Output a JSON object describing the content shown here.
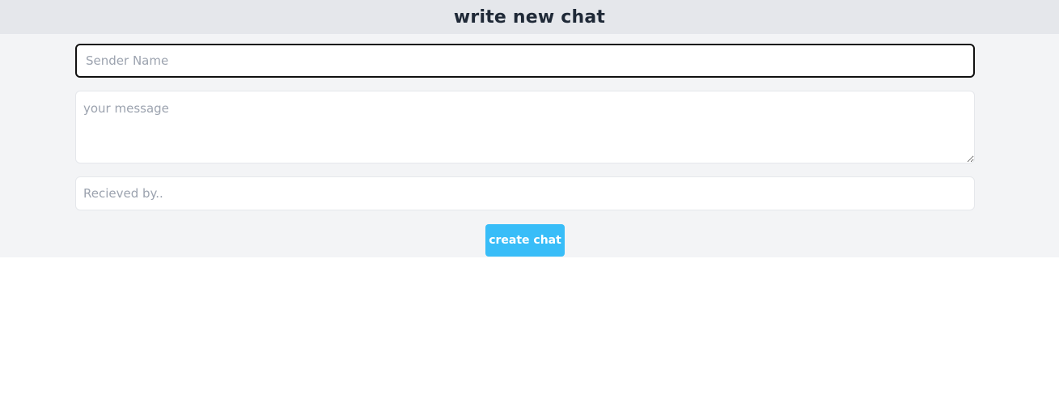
{
  "header": {
    "title": "write new chat"
  },
  "form": {
    "sender_placeholder": "Sender Name",
    "sender_value": "",
    "message_placeholder": "your message",
    "message_value": "",
    "receiver_placeholder": "Recieved by..",
    "receiver_value": "",
    "submit_label": "create chat"
  },
  "colors": {
    "header_bg": "#e5e7eb",
    "form_bg": "#f3f4f6",
    "button_bg": "#38bdf8",
    "title_text": "#1f2937",
    "placeholder_text": "#9ca3af"
  }
}
